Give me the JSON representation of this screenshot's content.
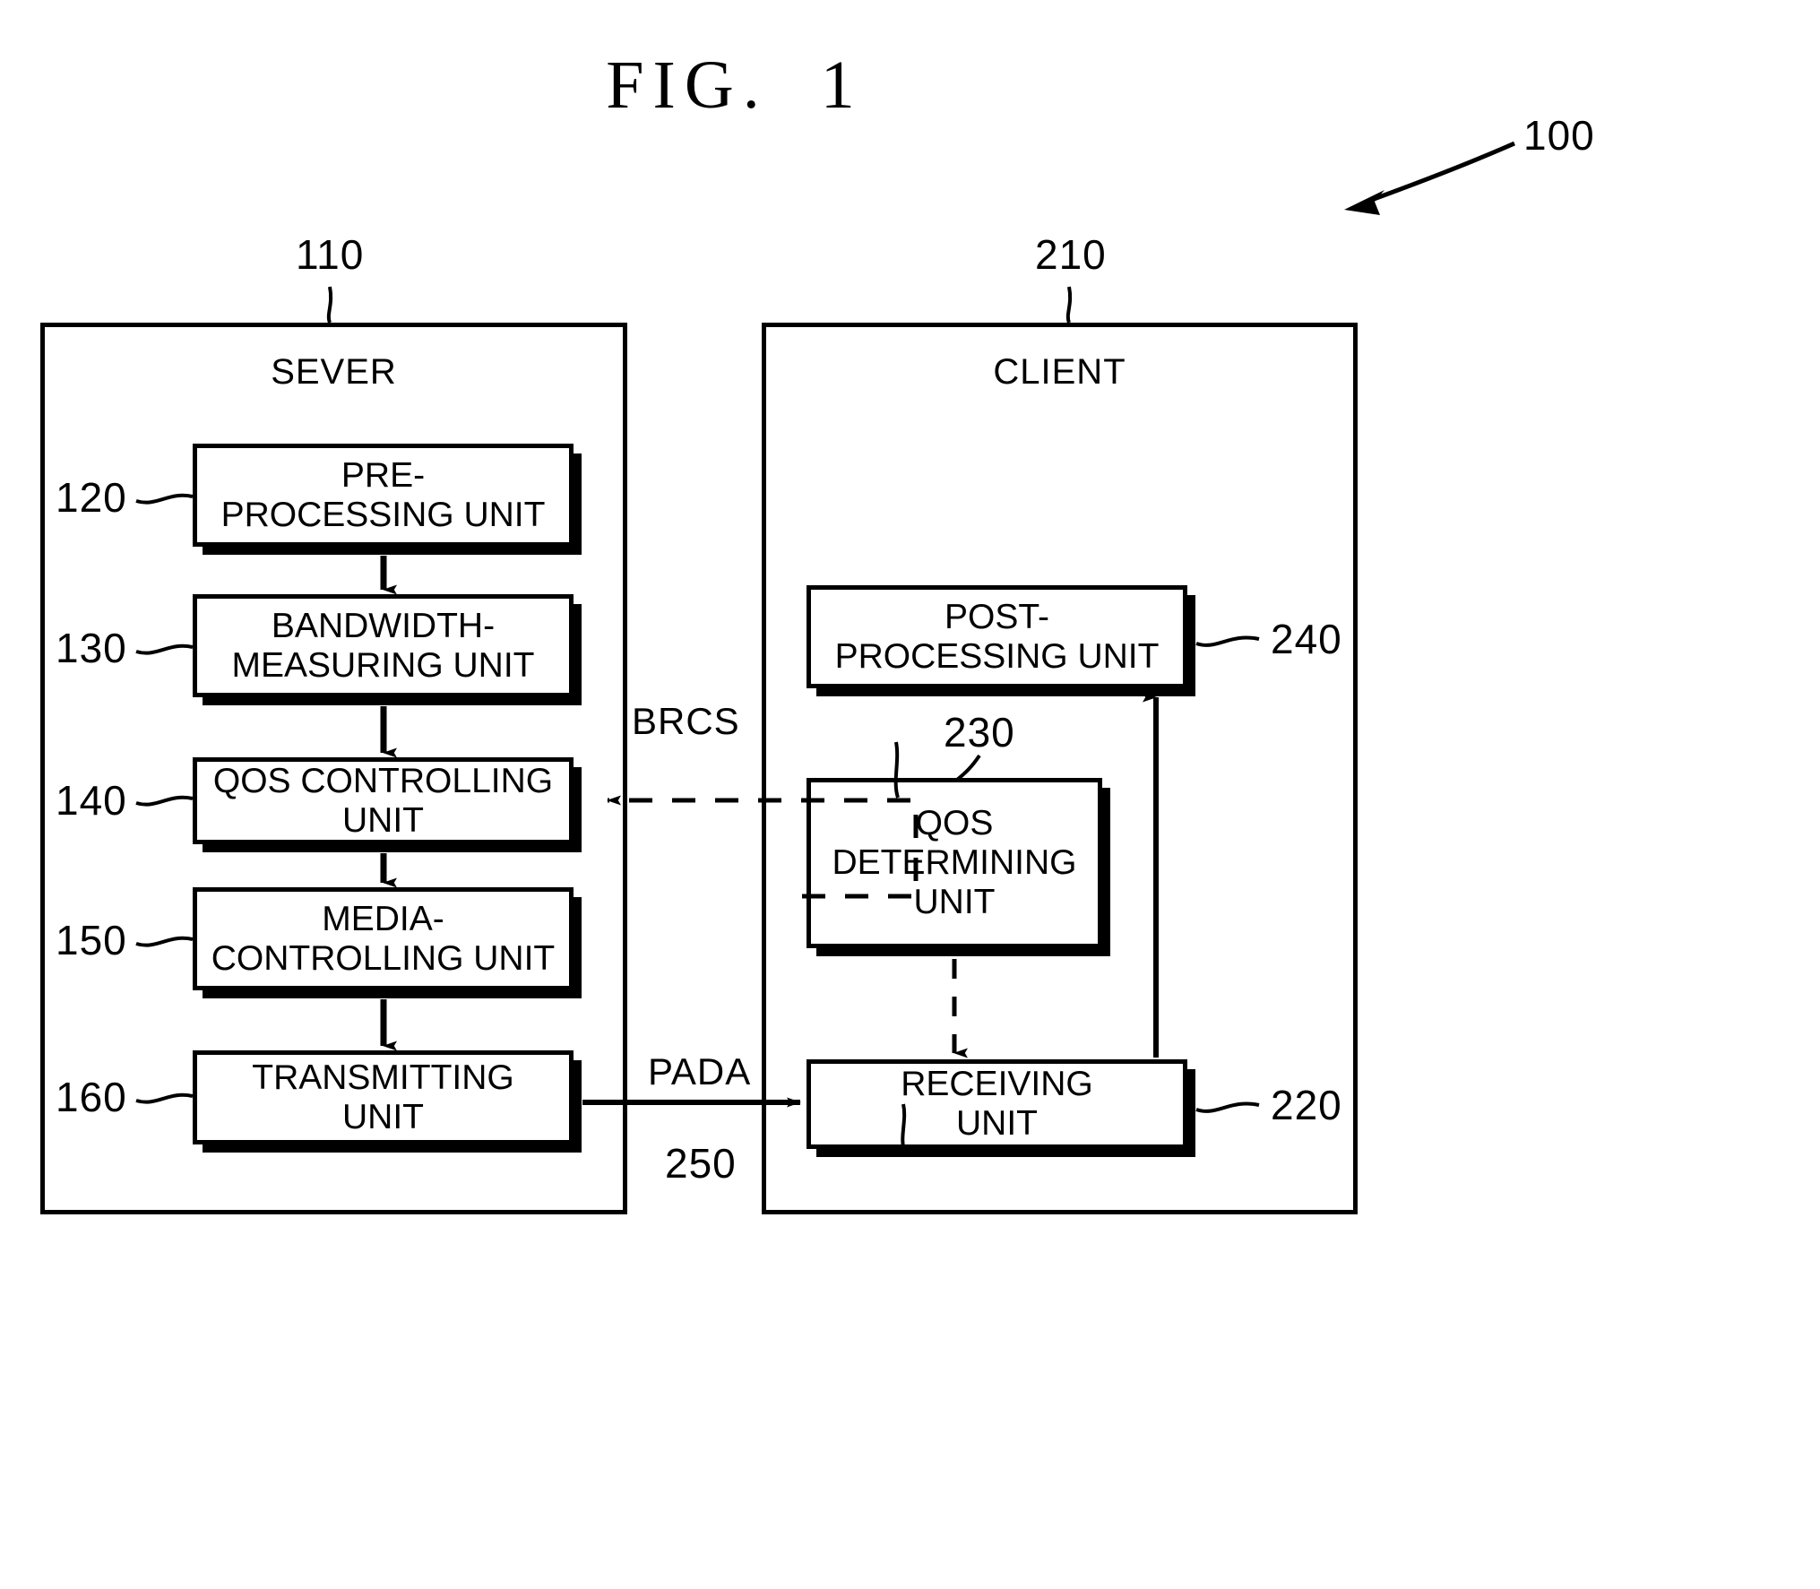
{
  "figure": {
    "title": "FIG.  1",
    "system_ref": "100"
  },
  "server": {
    "title": "SEVER",
    "ref": "110",
    "units": [
      {
        "ref": "120",
        "label": "PRE-\nPROCESSING UNIT"
      },
      {
        "ref": "130",
        "label": "BANDWIDTH-\nMEASURING UNIT"
      },
      {
        "ref": "140",
        "label": "QOS CONTROLLING\nUNIT"
      },
      {
        "ref": "150",
        "label": "MEDIA-\nCONTROLLING UNIT"
      },
      {
        "ref": "160",
        "label": "TRANSMITTING\nUNIT"
      }
    ]
  },
  "client": {
    "title": "CLIENT",
    "ref": "210",
    "units": [
      {
        "ref": "240",
        "label": "POST-\nPROCESSING UNIT"
      },
      {
        "ref": "230",
        "label": "QOS\nDETERMINING\nUNIT"
      },
      {
        "ref": "220",
        "label": "RECEIVING\nUNIT"
      }
    ]
  },
  "signals": [
    {
      "name": "BRCS",
      "label": "BRCS",
      "style": "dashed"
    },
    {
      "name": "PADA",
      "label": "PADA",
      "style": "solid",
      "ref": "250"
    }
  ],
  "colors": {
    "line": "#000000",
    "background": "#ffffff"
  }
}
